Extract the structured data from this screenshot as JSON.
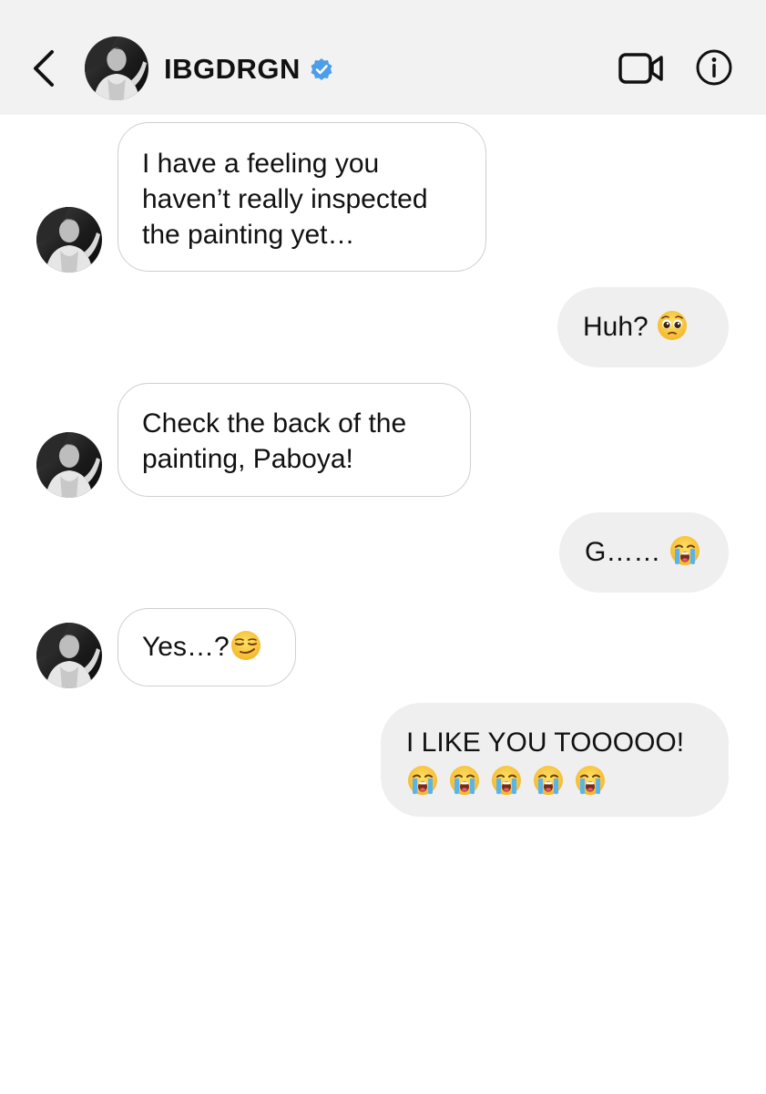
{
  "header": {
    "back_icon": "chevron-left-icon",
    "username": "IBGDRGN",
    "verified_icon": "verified-badge-icon",
    "video_icon": "video-camera-icon",
    "info_icon": "info-icon"
  },
  "colors": {
    "header_bg": "#f2f2f2",
    "incoming_bubble_border": "#cfcfcf",
    "outgoing_bubble_bg": "#efefef",
    "verified_blue": "#4c9ee8"
  },
  "messages": [
    {
      "direction": "incoming",
      "lines": [
        "I have a feeling you",
        "haven’t really inspected",
        "the painting yet…"
      ]
    },
    {
      "direction": "outgoing",
      "text": "Huh? ",
      "emoji": [
        "pleading-face-emoji"
      ]
    },
    {
      "direction": "incoming",
      "lines": [
        "Check the back of the",
        "painting, Paboya!"
      ]
    },
    {
      "direction": "outgoing",
      "text": "G…… ",
      "emoji": [
        "loudly-crying-face-emoji"
      ]
    },
    {
      "direction": "incoming",
      "text": "Yes…?",
      "emoji": [
        "smirking-face-emoji"
      ]
    },
    {
      "direction": "outgoing",
      "text": "I LIKE YOU TOOOOO!",
      "emoji": [
        "loudly-crying-face-emoji",
        "loudly-crying-face-emoji",
        "loudly-crying-face-emoji",
        "loudly-crying-face-emoji",
        "loudly-crying-face-emoji"
      ]
    }
  ]
}
